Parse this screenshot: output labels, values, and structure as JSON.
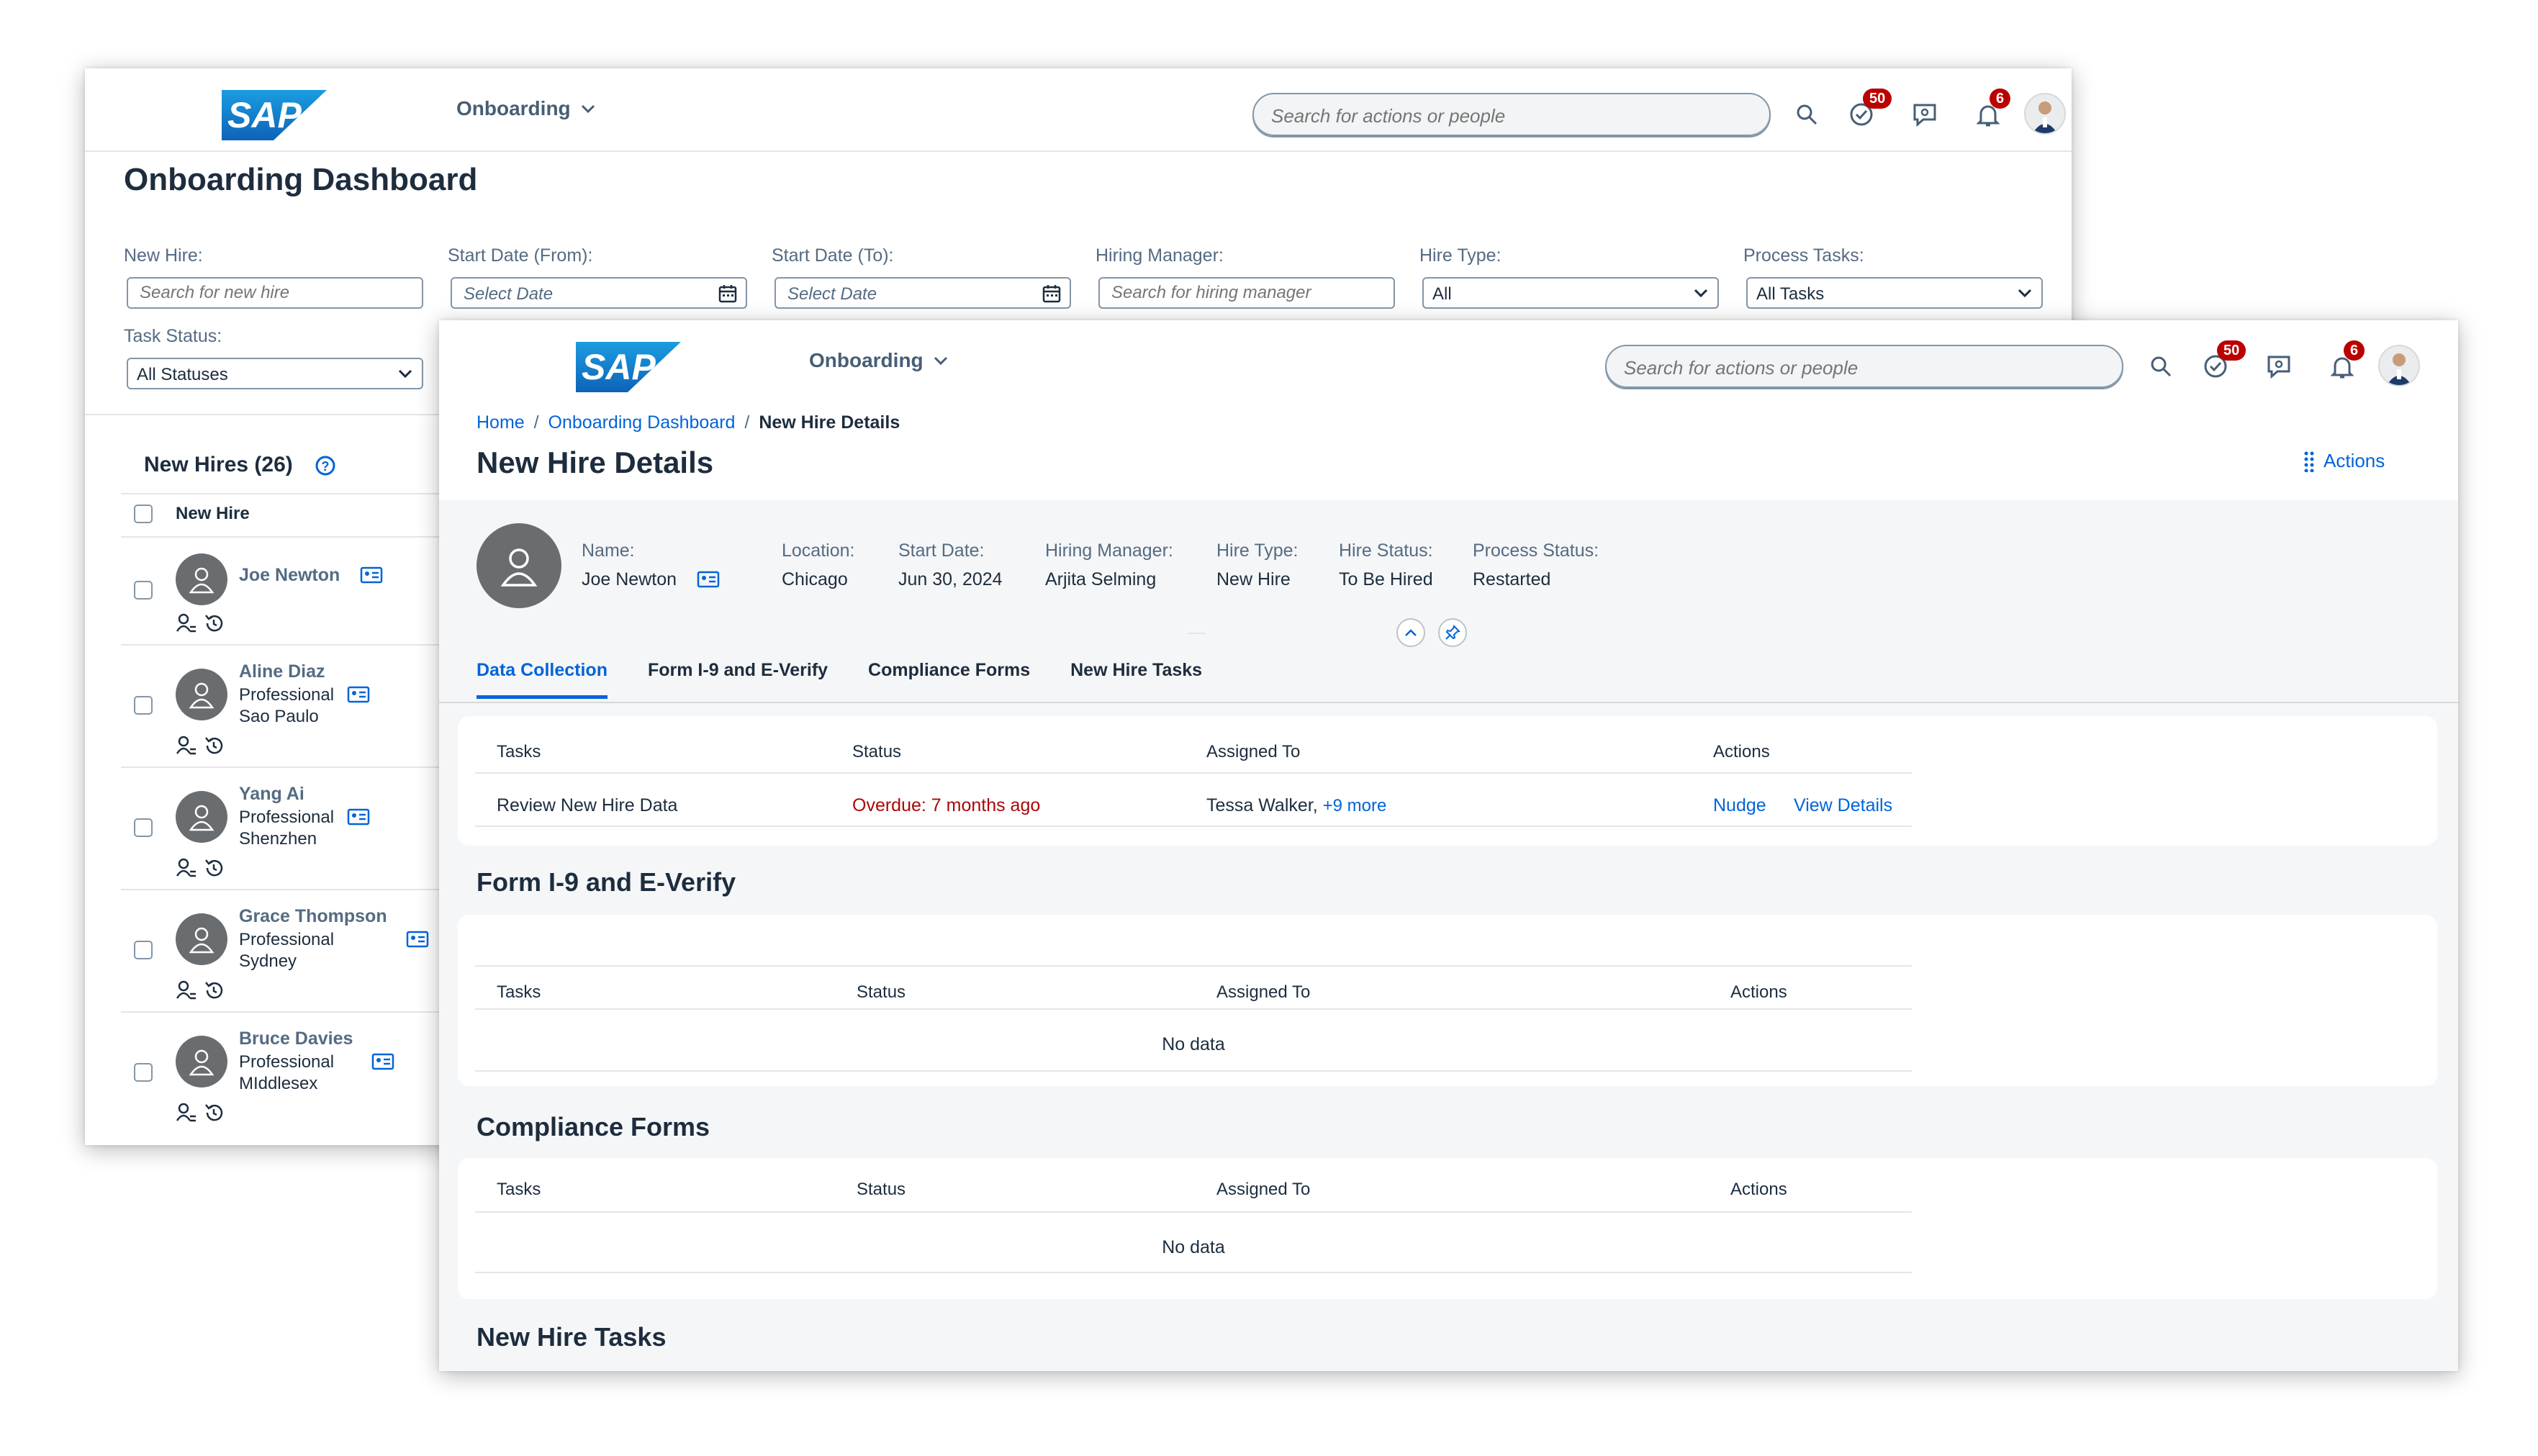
{
  "back": {
    "shell": {
      "app_name": "Onboarding",
      "search_placeholder": "Search for actions or people",
      "tasks_badge": "50",
      "notifications_badge": "6"
    },
    "title": "Onboarding Dashboard",
    "filters": {
      "new_hire_label": "New Hire:",
      "new_hire_placeholder": "Search for new hire",
      "start_from_label": "Start Date (From):",
      "start_from_placeholder": "Select Date",
      "start_to_label": "Start Date (To):",
      "start_to_placeholder": "Select Date",
      "hiring_manager_label": "Hiring Manager:",
      "hiring_manager_placeholder": "Search for hiring manager",
      "hire_type_label": "Hire Type:",
      "hire_type_value": "All",
      "process_tasks_label": "Process Tasks:",
      "process_tasks_value": "All Tasks",
      "task_status_label": "Task Status:",
      "task_status_value": "All Statuses"
    },
    "list": {
      "header": "New Hires (26)",
      "column": "New Hire",
      "items": [
        {
          "name": "Joe Newton",
          "line1": "",
          "line2": ""
        },
        {
          "name": "Aline Diaz",
          "line1": "Professional",
          "line2": "Sao Paulo"
        },
        {
          "name": "Yang Ai",
          "line1": "Professional",
          "line2": "Shenzhen"
        },
        {
          "name": "Grace Thompson",
          "line1": "Professional",
          "line2": "Sydney"
        },
        {
          "name": "Bruce Davies",
          "line1": "Professional",
          "line2": "MIddlesex"
        }
      ]
    }
  },
  "front": {
    "shell": {
      "app_name": "Onboarding",
      "search_placeholder": "Search for actions or people",
      "tasks_badge": "50",
      "notifications_badge": "6"
    },
    "breadcrumb": {
      "home": "Home",
      "dashboard": "Onboarding Dashboard",
      "current": "New Hire Details",
      "sep": "/"
    },
    "title": "New Hire Details",
    "actions_label": "Actions",
    "attributes": [
      {
        "label": "Name:",
        "value": "Joe Newton"
      },
      {
        "label": "Location:",
        "value": "Chicago"
      },
      {
        "label": "Start Date:",
        "value": "Jun 30, 2024"
      },
      {
        "label": "Hiring Manager:",
        "value": "Arjita Selming"
      },
      {
        "label": "Hire Type:",
        "value": "New Hire"
      },
      {
        "label": "Hire Status:",
        "value": "To Be Hired"
      },
      {
        "label": "Process Status:",
        "value": "Restarted"
      }
    ],
    "tabs": [
      "Data Collection",
      "Form I-9 and E-Verify",
      "Compliance Forms",
      "New Hire Tasks"
    ],
    "data_collection": {
      "columns": [
        "Tasks",
        "Status",
        "Assigned To",
        "Actions"
      ],
      "row": {
        "task": "Review New Hire Data",
        "status": "Overdue: 7 months ago",
        "assigned": "Tessa Walker,",
        "more": "+9 more",
        "nudge": "Nudge",
        "view": "View Details"
      }
    },
    "form_i9": {
      "title": "Form I-9 and E-Verify",
      "columns": [
        "Tasks",
        "Status",
        "Assigned To",
        "Actions"
      ],
      "empty": "No data"
    },
    "compliance": {
      "title": "Compliance Forms",
      "columns": [
        "Tasks",
        "Status",
        "Assigned To",
        "Actions"
      ],
      "empty": "No data"
    },
    "new_hire_tasks": {
      "title": "New Hire Tasks"
    }
  },
  "colors": {
    "brand_blue": "#0064d9",
    "overdue_red": "#aa0808",
    "badge_red": "#bb0000"
  }
}
